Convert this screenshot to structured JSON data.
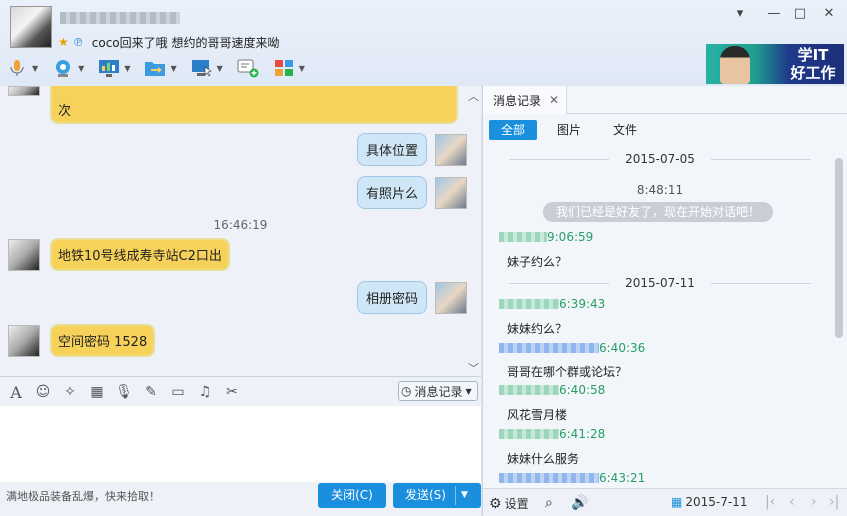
{
  "header": {
    "signature": "coco回来了哦 想约的哥哥速度来呦",
    "status_star": "★",
    "status_qq": "℗",
    "window_controls": [
      "▾",
      "—",
      "□",
      "✕"
    ]
  },
  "toolbar": {
    "items": [
      "voice-call",
      "video-call",
      "screen-share",
      "file-transfer",
      "remote-assist",
      "add-app",
      "apps"
    ]
  },
  "ad": {
    "line1": "学IT",
    "line2": "好工作"
  },
  "chat": {
    "top_partial_text": "次",
    "messages": [
      {
        "side": "right",
        "text": "具体位置"
      },
      {
        "side": "right",
        "text": "有照片么"
      },
      {
        "side": "left",
        "text": "地铁10号线成寿寺站C2口出"
      },
      {
        "side": "right",
        "text": "相册密码"
      },
      {
        "side": "left",
        "text": "空间密码  1528"
      }
    ],
    "timestamp": "16:46:19"
  },
  "input": {
    "history_button": "消息记录"
  },
  "bottom": {
    "promo": "满地极品装备乱爆，快来拾取！",
    "close_label": "关闭(C)",
    "send_label": "发送(S)"
  },
  "history": {
    "tab_label": "消息记录",
    "filters": {
      "all": "全部",
      "images": "图片",
      "files": "文件"
    },
    "date1": "2015-07-05",
    "time1": "8:48:11",
    "system_msg": "我们已经是好友了，现在开始对话吧！",
    "entries": [
      {
        "time": "9:06:59",
        "text": "妹子约么？",
        "color": "green"
      },
      {
        "time": "2015-07-11",
        "text": "",
        "color": "date"
      },
      {
        "time": "6:39:43",
        "text": "妹妹约么？",
        "color": "green"
      },
      {
        "time": "6:40:36",
        "text": "哥哥在哪个群或论坛？",
        "color": "blue"
      },
      {
        "time": "6:40:58",
        "text": "风花雪月楼",
        "color": "green"
      },
      {
        "time": "6:41:28",
        "text": "妹妹什么服务",
        "color": "green"
      },
      {
        "time": "6:43:21",
        "text": "",
        "color": "blue"
      }
    ],
    "settings_label": "设置",
    "current_date": "2015-7-11"
  }
}
